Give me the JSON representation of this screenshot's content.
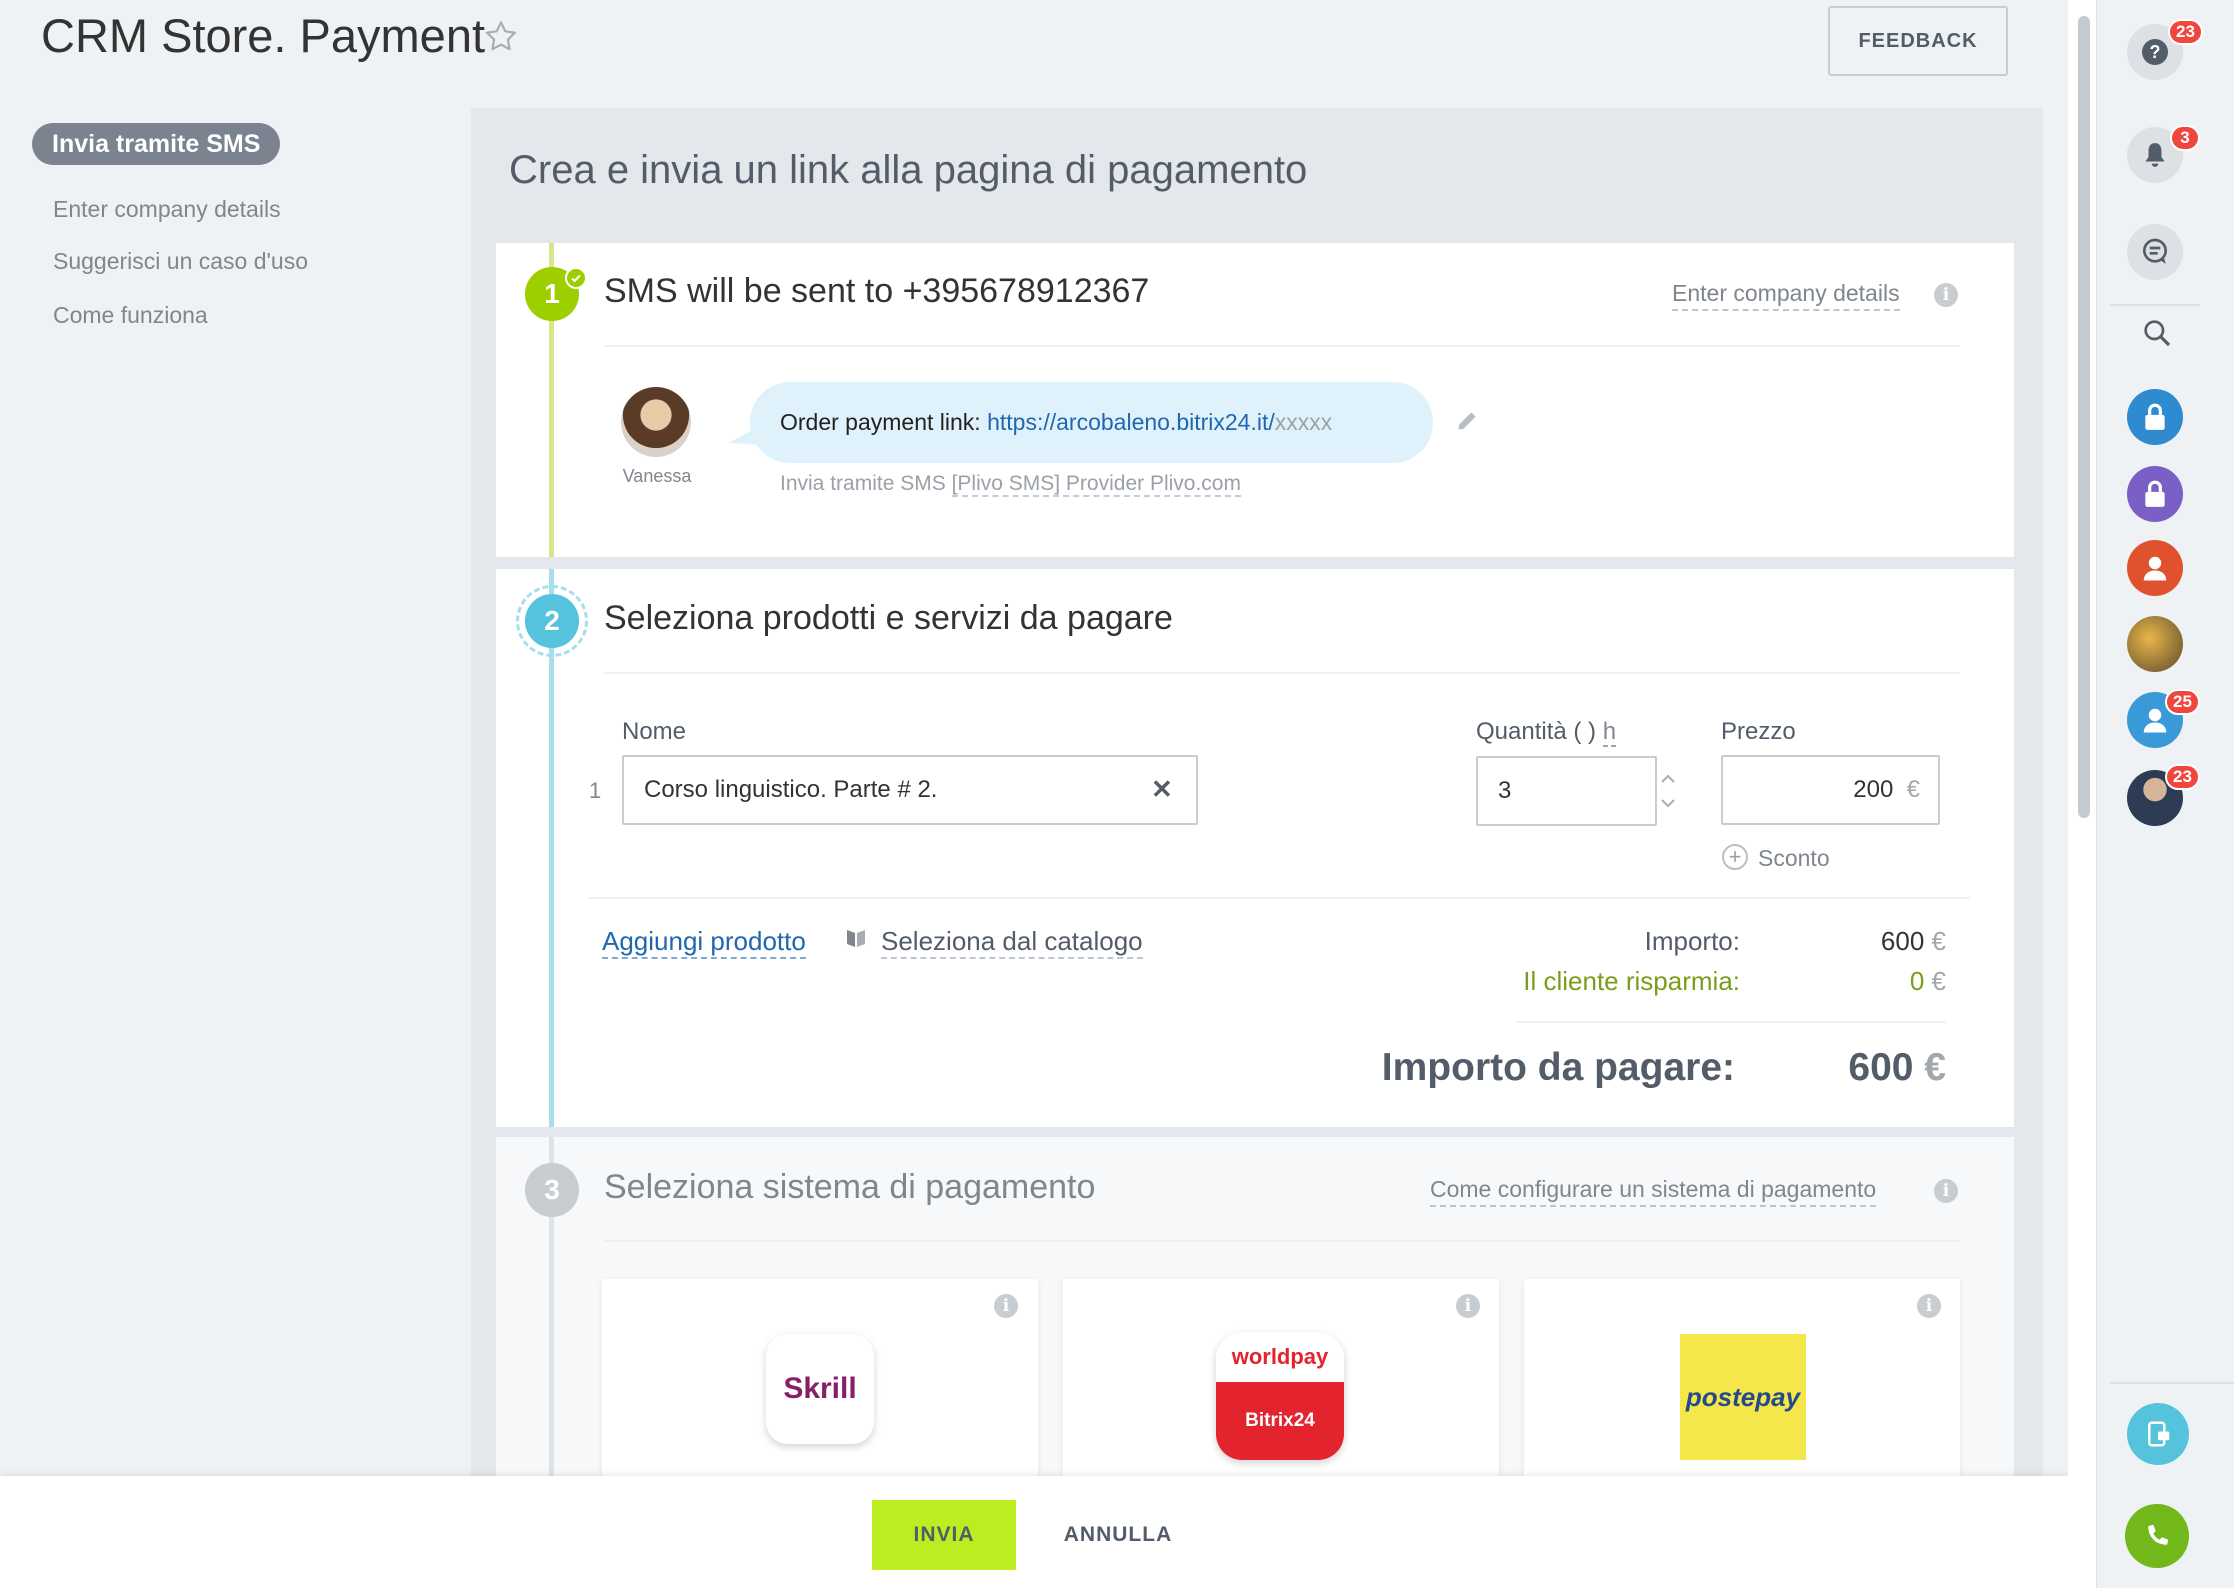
{
  "header": {
    "title": "CRM Store. Payment",
    "feedback_label": "FEEDBACK"
  },
  "sidebar": {
    "active_item": "Invia tramite SMS",
    "items": [
      {
        "label": "Enter company details"
      },
      {
        "label": "Suggerisci un caso d'uso"
      },
      {
        "label": "Come funziona"
      }
    ]
  },
  "main": {
    "title": "Crea e invia un link alla pagina di pagamento",
    "step1": {
      "number": "1",
      "title": "SMS will be sent to +395678912367",
      "link": "Enter company details",
      "sender_name": "Vanessa",
      "message_prefix": "Order payment link:",
      "message_url": "https://arcobaleno.bitrix24.it/",
      "message_suffix": "xxxxx",
      "provider_prefix": "Invia tramite SMS ",
      "provider_link": "[Plivo SMS] Provider Plivo.com"
    },
    "step2": {
      "number": "2",
      "title": "Seleziona prodotti e servizi da pagare",
      "col_name": "Nome",
      "col_qty": "Quantità ( )",
      "col_qty_unit": "h",
      "col_price": "Prezzo",
      "rows": [
        {
          "index": "1",
          "name": "Corso linguistico. Parte # 2.",
          "qty": "3",
          "price": "200",
          "currency": "€"
        }
      ],
      "discount_label": "Sconto",
      "add_product": "Aggiungi prodotto",
      "select_catalog": "Seleziona dal catalogo",
      "amount_label": "Importo:",
      "amount_value": "600",
      "savings_label": "Il cliente risparmia:",
      "savings_value": "0",
      "total_label": "Importo da pagare:",
      "total_value": "600",
      "currency": "€"
    },
    "step3": {
      "number": "3",
      "title": "Seleziona sistema di pagamento",
      "link": "Come configurare un sistema di pagamento",
      "systems": [
        {
          "name": "Skrill"
        },
        {
          "name": "worldpay",
          "sub": "Bitrix24"
        },
        {
          "name": "postepay"
        }
      ]
    }
  },
  "footer": {
    "send_label": "INVIA",
    "cancel_label": "ANNULLA"
  },
  "right_bar": {
    "help_badge": "23",
    "notifications_badge": "3",
    "user4_badge": "25",
    "user5_badge": "23"
  },
  "colors": {
    "step1": "#9dcf00",
    "step2": "#55c3db",
    "step3": "#c8cdd2",
    "send_button": "#bbed21",
    "badge": "#f0463e"
  }
}
